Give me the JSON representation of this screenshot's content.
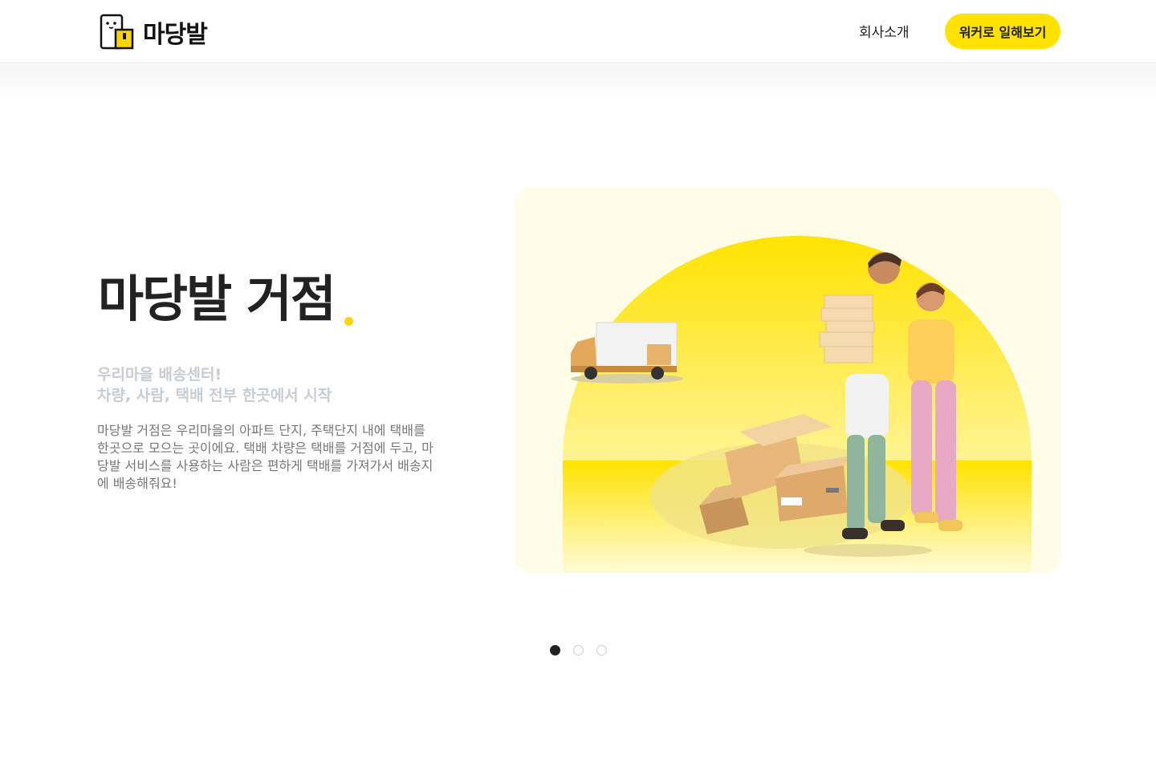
{
  "header": {
    "logo_text": "마당발",
    "nav_about": "회사소개",
    "cta_label": "워커로 일해보기"
  },
  "hero": {
    "title": "마당발 거점",
    "subtitle_line1": "우리마을 배송센터!",
    "subtitle_line2": "차량, 사람, 택배 전부 한곳에서 시작",
    "description": "마당발 거점은 우리마을의 아파트 단지, 주택단지 내에 택배를 한곳으로 모으는 곳이에요. 택배 차량은 택배를 거점에 두고, 마당발 서비스를 사용하는 사람은 편하게 택배를 가져가서 배송지에 배송해줘요!"
  },
  "carousel": {
    "slide_count": 3,
    "active_index": 0
  },
  "colors": {
    "brand_yellow": "#ffe200",
    "card_bg": "#fffde8",
    "text_dark": "#222222",
    "subtitle_gray": "#c8ccd3"
  }
}
